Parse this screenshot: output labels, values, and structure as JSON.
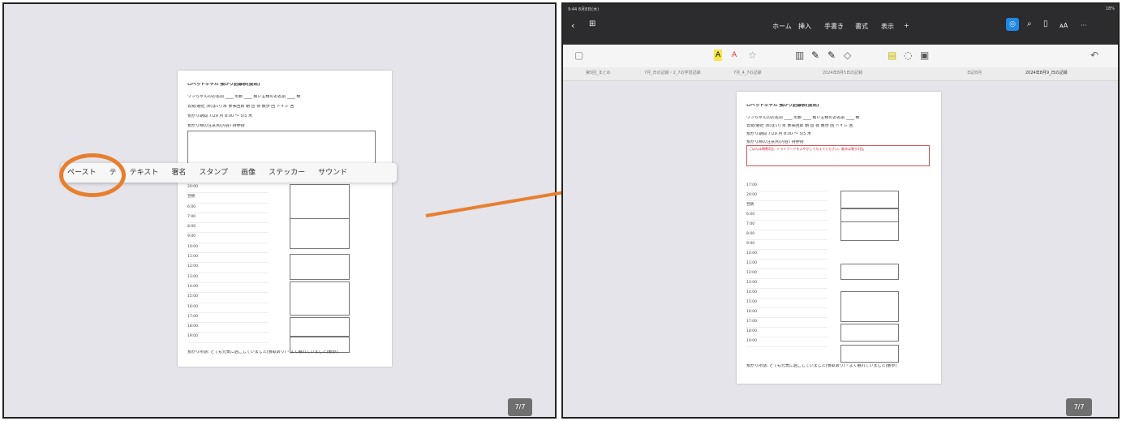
{
  "context_menu": {
    "items": [
      "ペースト",
      "テ",
      "テキスト",
      "署名",
      "スタンプ",
      "画像",
      "ステッカー",
      "サウンド"
    ]
  },
  "left_page_counter": "7/7",
  "right_page_counter": "7/7",
  "arrow_color": "#e87f2e",
  "right_status": {
    "time": "9:44 8月8日(木)",
    "battery": "18%"
  },
  "right_nav": {
    "items": [
      "ホーム",
      "挿入",
      "手書き",
      "書式",
      "表示"
    ]
  },
  "tabs": [
    "第5回_まとめ",
    "7月_日の記録・2_7の学習記録",
    "7月_4_7の記録",
    "2024年8月5日の記録",
    "日記8月",
    "2024年8月9_日の記録"
  ],
  "document": {
    "title": "ロペットホテル 預かり記録表(提出)",
    "lines": [
      "ワンちゃんのお名前 ____ 年齢 ____ 飼い主様のお名前 ____ 様",
      "去勢/避妊 済(はい) 未 食事回数 朝 昼 夜 散歩 回 トイレ 回",
      "預かり期間 7/29 月 8:00 ～ 5/5 木",
      "預かり時の注意点(内容)              持参物"
    ],
    "red_note": "ごはんは朝晩2回、ドライフードをふやかして与えてください。散歩は朝夕2回。",
    "times": [
      "17:00",
      "20:00",
      "翌朝",
      "6:00",
      "7:00",
      "8:00",
      "9:00",
      "10:00",
      "11:00",
      "12:00",
      "13:00",
      "14:00",
      "15:00",
      "16:00",
      "17:00",
      "18:00",
      "19:00"
    ],
    "footer": "預かり所感: とても元気に過ごしていました(食欲あり)・よく眠れていました(散歩)"
  }
}
